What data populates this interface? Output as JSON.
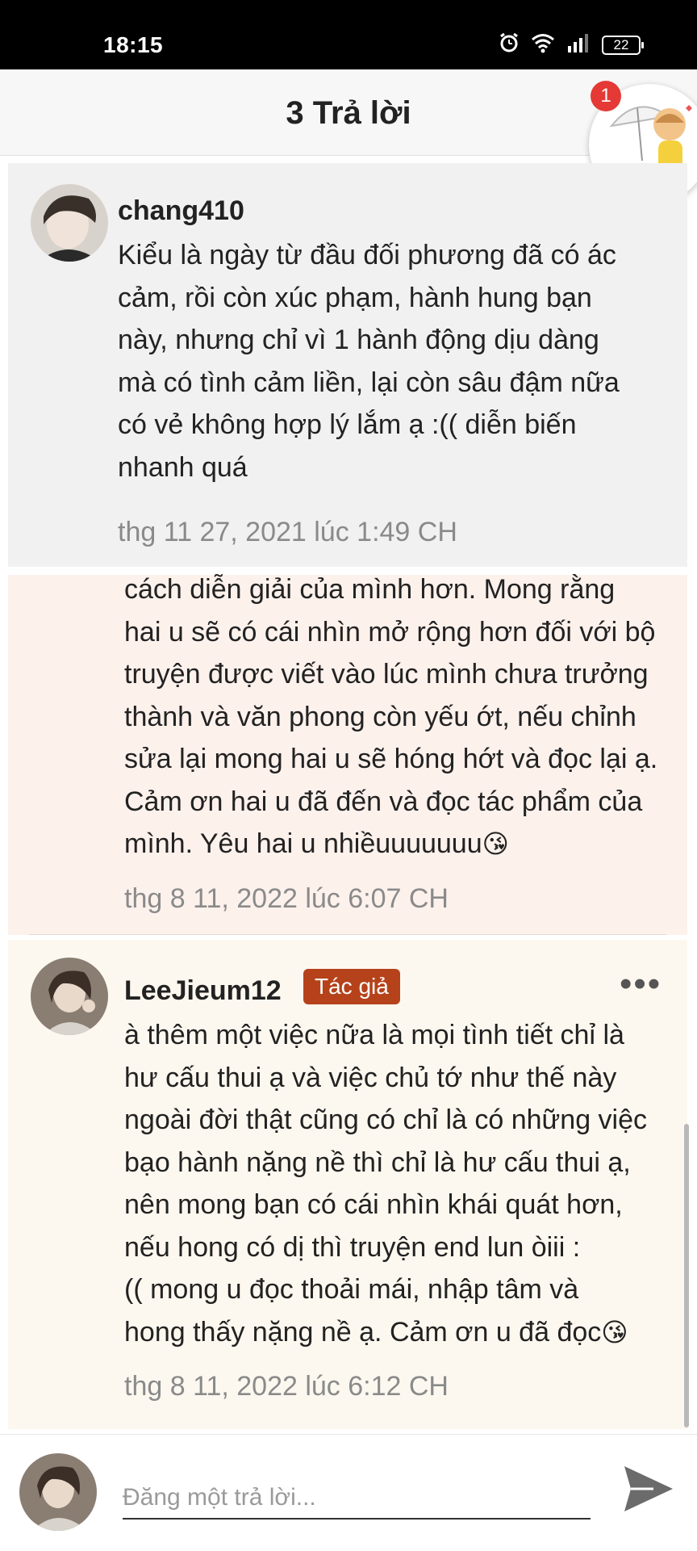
{
  "status_bar": {
    "time": "18:15",
    "battery": "22"
  },
  "header": {
    "title": "3 Trả lời",
    "notification_count": "1"
  },
  "comments": [
    {
      "username": "chang410",
      "lines": [
        "Kiểu là ngày từ đầu đối phương đã có ác",
        "cảm, rồi còn xúc phạm, hành hung bạn",
        "này, nhưng chỉ vì 1 hành động dịu dàng",
        "mà có tình cảm liền, lại còn sâu đậm nữa",
        "có vẻ không hợp lý lắm ạ :(( diễn biến",
        "nhanh quá"
      ],
      "timestamp": "thg 11 27, 2021 lúc 1:49 CH"
    },
    {
      "lines": [
        "cách diễn giải của mình hơn. Mong rằng",
        "hai u sẽ có cái nhìn mở rộng hơn đối với bộ",
        "truyện được viết vào lúc mình chưa trưởng",
        "thành và văn phong còn yếu ớt, nếu chỉnh",
        "sửa lại mong hai u sẽ hóng hớt và đọc lại ạ.",
        "Cảm ơn hai u đã đến và đọc tác phẩm của",
        "mình. Yêu hai u nhiềuuuuuuu"
      ],
      "emoji": "😘",
      "timestamp": "thg 8 11, 2022 lúc 6:07 CH"
    },
    {
      "username": "LeeJieum12",
      "badge": "Tác giả",
      "more": "•••",
      "lines": [
        "à thêm một việc nữa là mọi tình tiết chỉ là",
        "hư cấu thui ạ và việc chủ tớ như thế này",
        "ngoài đời thật cũng có chỉ là có những việc",
        "bạo hành nặng nề thì chỉ là hư cấu thui ạ,",
        "nên mong bạn có cái nhìn khái quát hơn,",
        "nếu hong có dị thì truyện end lun òiii :",
        "(( mong u đọc thoải mái, nhập tâm và",
        "hong thấy nặng nề ạ. Cảm ơn u đã đọc"
      ],
      "emoji": "😘",
      "timestamp": "thg 8 11, 2022 lúc 6:12 CH"
    }
  ],
  "reply_bar": {
    "placeholder": "Đăng một trả lời..."
  },
  "colors": {
    "author_badge": "#b5421a",
    "header_bg": "#f7f7f7",
    "comment1_bg": "#f1f1f1",
    "comment2_bg": "#fdf1ec",
    "comment3_bg": "#fdf8ef",
    "notification": "#e53935"
  },
  "icons": [
    "alarm-icon",
    "wifi-icon",
    "signal-icon",
    "battery-icon",
    "send-icon",
    "avatar-icon"
  ]
}
